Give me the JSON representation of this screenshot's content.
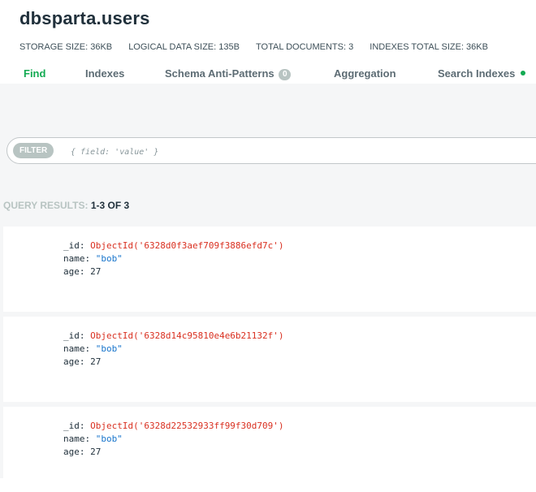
{
  "collection": {
    "title": "dbsparta.users"
  },
  "stats": [
    {
      "label": "STORAGE SIZE: 36KB"
    },
    {
      "label": "LOGICAL DATA SIZE: 135B"
    },
    {
      "label": "TOTAL DOCUMENTS: 3"
    },
    {
      "label": "INDEXES TOTAL SIZE: 36KB"
    }
  ],
  "tabs": [
    {
      "label": "Find",
      "active": true
    },
    {
      "label": "Indexes"
    },
    {
      "label": "Schema Anti-Patterns",
      "badge": "0"
    },
    {
      "label": "Aggregation"
    },
    {
      "label": "Search Indexes"
    }
  ],
  "filter": {
    "pill": "FILTER",
    "placeholder": "{ field: 'value' }",
    "value": ""
  },
  "results": {
    "label_prefix": "QUERY RESULTS:",
    "count": "1-3 OF 3"
  },
  "documents": [
    {
      "id_key": "_id:",
      "id_value": "ObjectId('6328d0f3aef709f3886efd7c')",
      "name_key": "name:",
      "name_value": "\"bob\"",
      "age_key": "age:",
      "age_value": "27"
    },
    {
      "id_key": "_id:",
      "id_value": "ObjectId('6328d14c95810e4e6b21132f')",
      "name_key": "name:",
      "name_value": "\"bob\"",
      "age_key": "age:",
      "age_value": "27"
    },
    {
      "id_key": "_id:",
      "id_value": "ObjectId('6328d22532933ff99f30d709')",
      "name_key": "name:",
      "name_value": "\"bob\"",
      "age_key": "age:",
      "age_value": "27"
    }
  ],
  "colors": {
    "accent": "#13aa52",
    "object_id": "#d93020",
    "string": "#1a76cc",
    "muted": "#b8c4c2"
  }
}
